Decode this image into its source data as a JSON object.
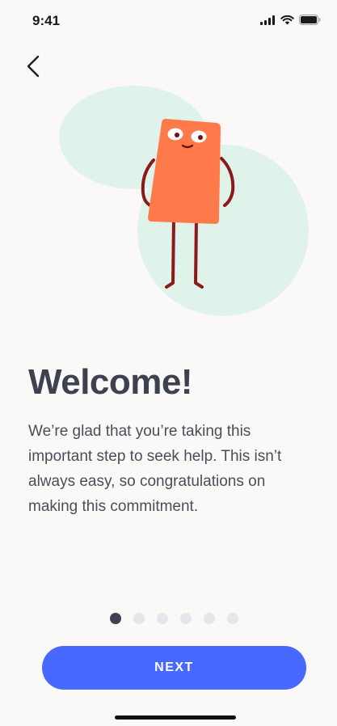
{
  "status_bar": {
    "time": "9:41",
    "icons": [
      "signal-icon",
      "wifi-icon",
      "battery-icon"
    ]
  },
  "nav": {
    "back_icon": "chevron-left-icon"
  },
  "illustration": {
    "description_icon": "character-illustration",
    "colors": {
      "blob": "#dff3ea",
      "body": "#ff7a4a",
      "limbs": "#8b1a1a"
    }
  },
  "content": {
    "title": "Welcome!",
    "body": "We’re glad that you’re taking this important step to seek help. This isn’t always easy, so congratulations on making this commitment."
  },
  "pagination": {
    "total": 6,
    "current": 1
  },
  "actions": {
    "next_label": "NEXT"
  },
  "colors": {
    "accent": "#4769ff",
    "title": "#3d4150",
    "background": "#faf9f7"
  }
}
